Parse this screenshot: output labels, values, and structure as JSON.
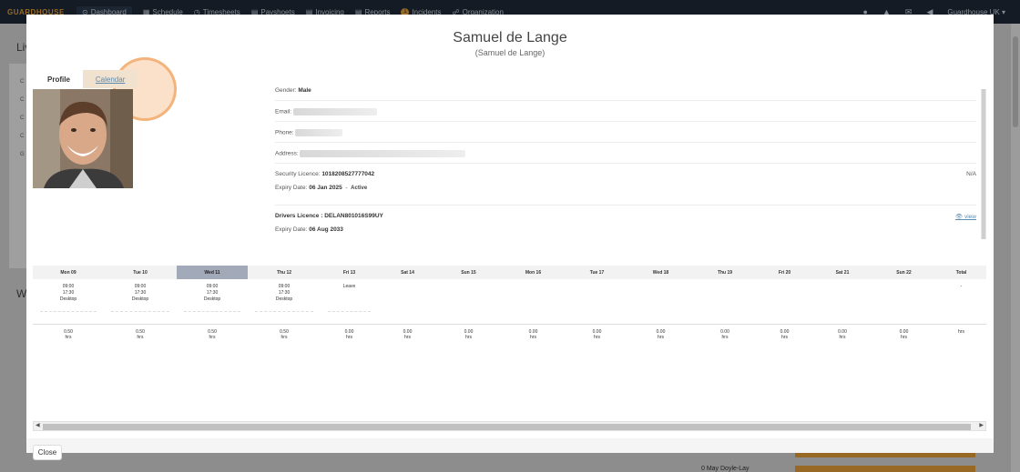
{
  "app": {
    "brand": "GUARDHOUSE",
    "nav": [
      {
        "icon": "dashboard-icon",
        "glyph": "⊙",
        "label": "Dashboard"
      },
      {
        "icon": "calendar-icon",
        "glyph": "▦",
        "label": "Schedule"
      },
      {
        "icon": "clock-icon",
        "glyph": "◷",
        "label": "Timesheets"
      },
      {
        "icon": "payslip-icon",
        "glyph": "▤",
        "label": "Payshoets"
      },
      {
        "icon": "invoice-icon",
        "glyph": "▤",
        "label": "Invoicing"
      },
      {
        "icon": "reports-icon",
        "glyph": "▤",
        "label": "Reports"
      },
      {
        "icon": "incidents-icon",
        "glyph": "1",
        "label": "Incidents"
      },
      {
        "icon": "organization-icon",
        "glyph": "☍",
        "label": "Organization"
      }
    ],
    "user_menu": "Guardhouse UK",
    "background": {
      "title_partial": "Liv",
      "title_partial_2": "W",
      "side_items": [
        "C",
        "C",
        "C",
        "C",
        "G"
      ],
      "list_name": "0 May Doyle-Lay"
    }
  },
  "modal": {
    "name": "Samuel de Lange",
    "subname": "(Samuel de Lange)",
    "tabs": {
      "profile": "Profile",
      "calendar": "Calendar"
    },
    "details": {
      "gender_label": "Gender:",
      "gender": "Male",
      "email_label": "Email:",
      "phone_label": "Phone:",
      "address_label": "Address:",
      "security_label": "Security Licence:",
      "security_number": "1018208527777042",
      "security_na": "N/A",
      "security_expiry_label": "Expiry Date:",
      "security_expiry": "06 Jan 2025",
      "security_sep": "-",
      "security_status": "Active",
      "drivers_label": "Drivers Licence :",
      "drivers_number": "DELAN801016S99UY",
      "drivers_view": "view",
      "drivers_expiry_label": "Expiry Date:",
      "drivers_expiry": "06 Aug 2033"
    },
    "calendar": {
      "days": [
        {
          "label": "Mon 09",
          "w": 78,
          "entry": [
            "09:00",
            "17:30",
            "Desktop"
          ],
          "hours": [
            "0.50",
            "hrs"
          ]
        },
        {
          "label": "Tue 10",
          "w": 80,
          "entry": [
            "09:00",
            "17:30",
            "Desktop"
          ],
          "hours": [
            "0.50",
            "hrs"
          ]
        },
        {
          "label": "Wed 11",
          "w": 78,
          "entry": [
            "09:00",
            "17:30",
            "Desktop"
          ],
          "hours": [
            "0.50",
            "hrs"
          ],
          "selected": true
        },
        {
          "label": "Thu 12",
          "w": 80,
          "entry": [
            "09:00",
            "17:30",
            "Desktop"
          ],
          "hours": [
            "0.50",
            "hrs"
          ]
        },
        {
          "label": "Fri 13",
          "w": 63,
          "entry": [
            "Leave"
          ],
          "hours": [
            "0.00",
            "hrs"
          ]
        },
        {
          "label": "Sat 14",
          "w": 65,
          "entry": [],
          "hours": [
            "0.00",
            "hrs"
          ]
        },
        {
          "label": "Sun 15",
          "w": 69,
          "entry": [],
          "hours": [
            "0.00",
            "hrs"
          ]
        },
        {
          "label": "Mon 16",
          "w": 73,
          "entry": [],
          "hours": [
            "0.00",
            "hrs"
          ]
        },
        {
          "label": "Tue 17",
          "w": 67,
          "entry": [],
          "hours": [
            "0.00",
            "hrs"
          ]
        },
        {
          "label": "Wed 18",
          "w": 73,
          "entry": [],
          "hours": [
            "0.00",
            "hrs"
          ]
        },
        {
          "label": "Thu 19",
          "w": 68,
          "entry": [],
          "hours": [
            "0.00",
            "hrs"
          ]
        },
        {
          "label": "Fri 20",
          "w": 63,
          "entry": [],
          "hours": [
            "0.00",
            "hrs"
          ]
        },
        {
          "label": "Sat 21",
          "w": 64,
          "entry": [],
          "hours": [
            "0.00",
            "hrs"
          ]
        },
        {
          "label": "Sun 22",
          "w": 71,
          "entry": [],
          "hours": [
            "0.00",
            "hrs"
          ]
        },
        {
          "label": "Total",
          "w": 55,
          "entry": [
            "-"
          ],
          "hours": [
            "",
            "hrs"
          ]
        }
      ]
    },
    "close_label": "Close"
  }
}
